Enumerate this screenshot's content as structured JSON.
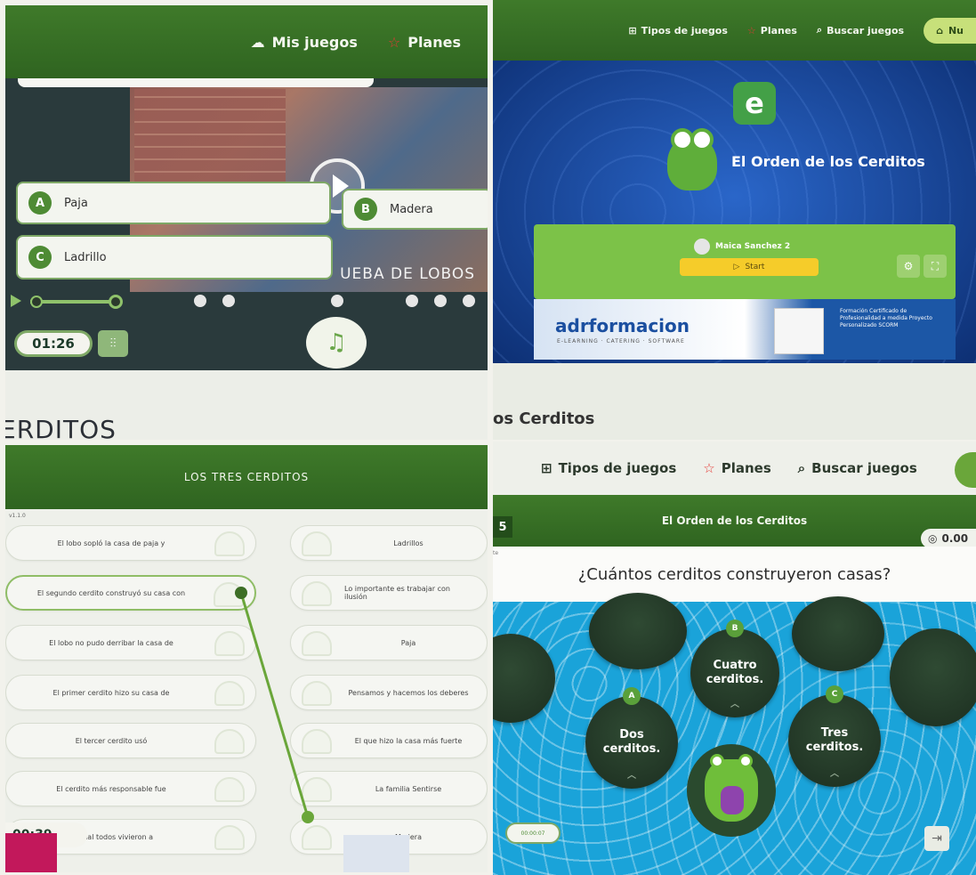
{
  "panel1": {
    "nav": [
      {
        "label": "Mis juegos",
        "icon": "cloud-icon"
      },
      {
        "label": "Planes",
        "icon": "star-icon"
      }
    ],
    "scene_label": "UEBA DE LOBOS",
    "answers": [
      {
        "letter": "A",
        "text": "Paja"
      },
      {
        "letter": "B",
        "text": "Madera"
      },
      {
        "letter": "C",
        "text": "Ladrillo"
      }
    ],
    "timer": "01:26",
    "section_heading": "ERDITOS"
  },
  "panel2": {
    "nav": [
      {
        "label": "Tipos de juegos",
        "icon": "grid-icon"
      },
      {
        "label": "Planes",
        "icon": "star-icon"
      },
      {
        "label": "Buscar juegos",
        "icon": "search-icon"
      }
    ],
    "new_button": "Nu",
    "logo_letter": "e",
    "game_title": "El Orden de los Cerditos",
    "player": "Maica Sanchez 2",
    "start_label": "Start",
    "ad": {
      "brand": "adrformacion",
      "tagline": "E-LEARNING · CATERING · SOFTWARE",
      "copy": "Formación Certificado de Profesionalidad a medida Proyecto Personalizado SCORM"
    },
    "section_heading": "os Cerditos"
  },
  "panel3": {
    "title": "LOS TRES CERDITOS",
    "version": "v1.1.0",
    "left_items": [
      "El lobo sopló la casa de paja y",
      "El segundo cerdito construyó su casa con",
      "El lobo no pudo derribar la casa de",
      "El primer cerdito hizo su casa de",
      "El tercer cerdito usó",
      "El cerdito más responsable fue",
      "Al final todos vivieron a"
    ],
    "right_items": [
      "Ladrillos",
      "Lo importante es trabajar con ilusión",
      "Paja",
      "Pensamos y hacemos los deberes",
      "El que hizo la casa más fuerte",
      "La familia Sentirse",
      "Madera"
    ],
    "timer": "00:39"
  },
  "panel4": {
    "nav": [
      {
        "label": "Tipos de juegos",
        "icon": "grid-icon"
      },
      {
        "label": "Planes",
        "icon": "star-icon"
      },
      {
        "label": "Buscar juegos",
        "icon": "search-icon"
      }
    ],
    "level": "5",
    "game_title": "El Orden de los Cerditos",
    "score": "0.00",
    "question_tag": "te",
    "question": "¿Cuántos cerditos construyeron casas?",
    "options": [
      {
        "letter": "A",
        "text": "Dos cerditos."
      },
      {
        "letter": "B",
        "text": "Cuatro cerditos."
      },
      {
        "letter": "C",
        "text": "Tres cerditos."
      }
    ],
    "clock": "00:00:07"
  },
  "colors": {
    "brand_green": "#3f7a2a",
    "accent_green": "#7cc248",
    "pond_blue": "#1aa3d9",
    "start_yellow": "#f5cc2a"
  }
}
